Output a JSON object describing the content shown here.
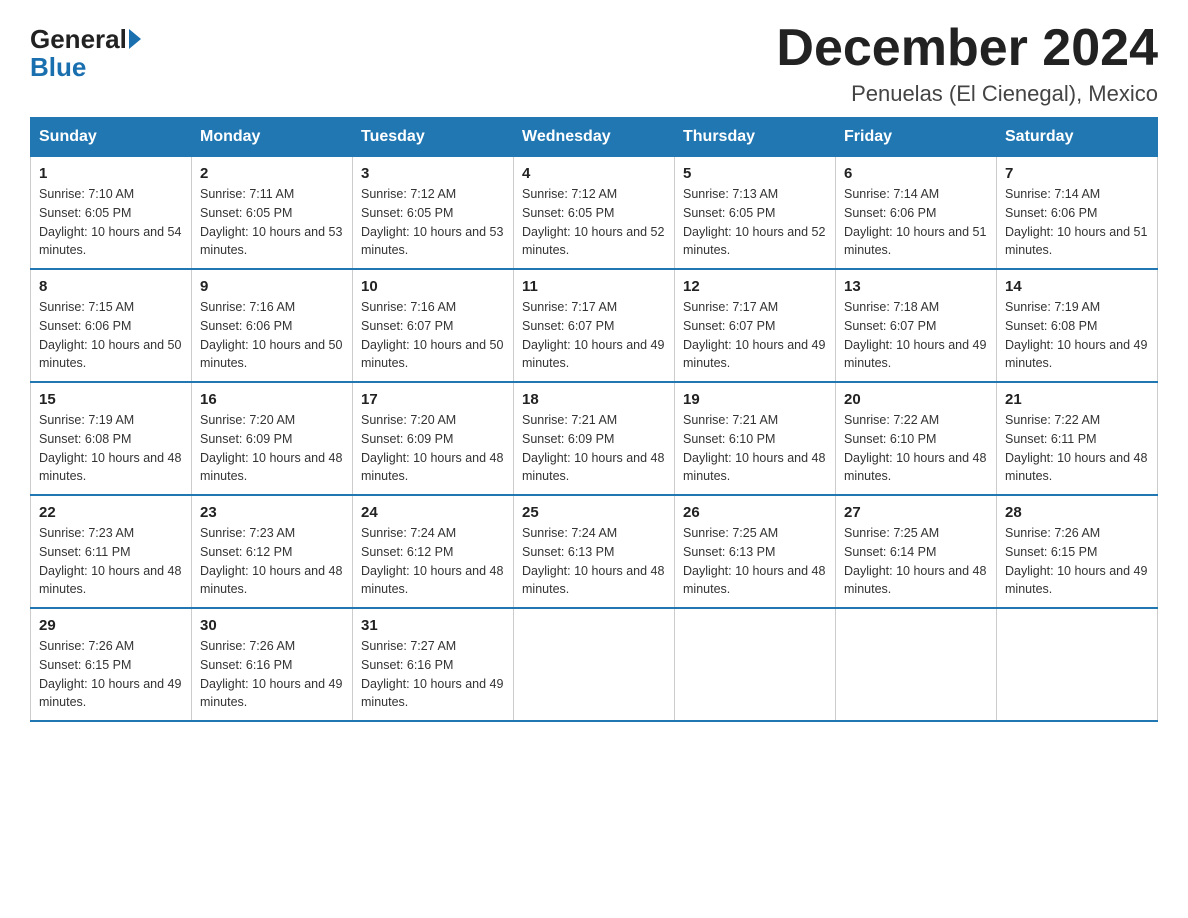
{
  "header": {
    "logo_general": "General",
    "logo_blue": "Blue",
    "month_title": "December 2024",
    "subtitle": "Penuelas (El Cienegal), Mexico"
  },
  "days_of_week": [
    "Sunday",
    "Monday",
    "Tuesday",
    "Wednesday",
    "Thursday",
    "Friday",
    "Saturday"
  ],
  "weeks": [
    [
      {
        "day": "1",
        "sunrise": "7:10 AM",
        "sunset": "6:05 PM",
        "daylight": "10 hours and 54 minutes."
      },
      {
        "day": "2",
        "sunrise": "7:11 AM",
        "sunset": "6:05 PM",
        "daylight": "10 hours and 53 minutes."
      },
      {
        "day": "3",
        "sunrise": "7:12 AM",
        "sunset": "6:05 PM",
        "daylight": "10 hours and 53 minutes."
      },
      {
        "day": "4",
        "sunrise": "7:12 AM",
        "sunset": "6:05 PM",
        "daylight": "10 hours and 52 minutes."
      },
      {
        "day": "5",
        "sunrise": "7:13 AM",
        "sunset": "6:05 PM",
        "daylight": "10 hours and 52 minutes."
      },
      {
        "day": "6",
        "sunrise": "7:14 AM",
        "sunset": "6:06 PM",
        "daylight": "10 hours and 51 minutes."
      },
      {
        "day": "7",
        "sunrise": "7:14 AM",
        "sunset": "6:06 PM",
        "daylight": "10 hours and 51 minutes."
      }
    ],
    [
      {
        "day": "8",
        "sunrise": "7:15 AM",
        "sunset": "6:06 PM",
        "daylight": "10 hours and 50 minutes."
      },
      {
        "day": "9",
        "sunrise": "7:16 AM",
        "sunset": "6:06 PM",
        "daylight": "10 hours and 50 minutes."
      },
      {
        "day": "10",
        "sunrise": "7:16 AM",
        "sunset": "6:07 PM",
        "daylight": "10 hours and 50 minutes."
      },
      {
        "day": "11",
        "sunrise": "7:17 AM",
        "sunset": "6:07 PM",
        "daylight": "10 hours and 49 minutes."
      },
      {
        "day": "12",
        "sunrise": "7:17 AM",
        "sunset": "6:07 PM",
        "daylight": "10 hours and 49 minutes."
      },
      {
        "day": "13",
        "sunrise": "7:18 AM",
        "sunset": "6:07 PM",
        "daylight": "10 hours and 49 minutes."
      },
      {
        "day": "14",
        "sunrise": "7:19 AM",
        "sunset": "6:08 PM",
        "daylight": "10 hours and 49 minutes."
      }
    ],
    [
      {
        "day": "15",
        "sunrise": "7:19 AM",
        "sunset": "6:08 PM",
        "daylight": "10 hours and 48 minutes."
      },
      {
        "day": "16",
        "sunrise": "7:20 AM",
        "sunset": "6:09 PM",
        "daylight": "10 hours and 48 minutes."
      },
      {
        "day": "17",
        "sunrise": "7:20 AM",
        "sunset": "6:09 PM",
        "daylight": "10 hours and 48 minutes."
      },
      {
        "day": "18",
        "sunrise": "7:21 AM",
        "sunset": "6:09 PM",
        "daylight": "10 hours and 48 minutes."
      },
      {
        "day": "19",
        "sunrise": "7:21 AM",
        "sunset": "6:10 PM",
        "daylight": "10 hours and 48 minutes."
      },
      {
        "day": "20",
        "sunrise": "7:22 AM",
        "sunset": "6:10 PM",
        "daylight": "10 hours and 48 minutes."
      },
      {
        "day": "21",
        "sunrise": "7:22 AM",
        "sunset": "6:11 PM",
        "daylight": "10 hours and 48 minutes."
      }
    ],
    [
      {
        "day": "22",
        "sunrise": "7:23 AM",
        "sunset": "6:11 PM",
        "daylight": "10 hours and 48 minutes."
      },
      {
        "day": "23",
        "sunrise": "7:23 AM",
        "sunset": "6:12 PM",
        "daylight": "10 hours and 48 minutes."
      },
      {
        "day": "24",
        "sunrise": "7:24 AM",
        "sunset": "6:12 PM",
        "daylight": "10 hours and 48 minutes."
      },
      {
        "day": "25",
        "sunrise": "7:24 AM",
        "sunset": "6:13 PM",
        "daylight": "10 hours and 48 minutes."
      },
      {
        "day": "26",
        "sunrise": "7:25 AM",
        "sunset": "6:13 PM",
        "daylight": "10 hours and 48 minutes."
      },
      {
        "day": "27",
        "sunrise": "7:25 AM",
        "sunset": "6:14 PM",
        "daylight": "10 hours and 48 minutes."
      },
      {
        "day": "28",
        "sunrise": "7:26 AM",
        "sunset": "6:15 PM",
        "daylight": "10 hours and 49 minutes."
      }
    ],
    [
      {
        "day": "29",
        "sunrise": "7:26 AM",
        "sunset": "6:15 PM",
        "daylight": "10 hours and 49 minutes."
      },
      {
        "day": "30",
        "sunrise": "7:26 AM",
        "sunset": "6:16 PM",
        "daylight": "10 hours and 49 minutes."
      },
      {
        "day": "31",
        "sunrise": "7:27 AM",
        "sunset": "6:16 PM",
        "daylight": "10 hours and 49 minutes."
      },
      null,
      null,
      null,
      null
    ]
  ]
}
